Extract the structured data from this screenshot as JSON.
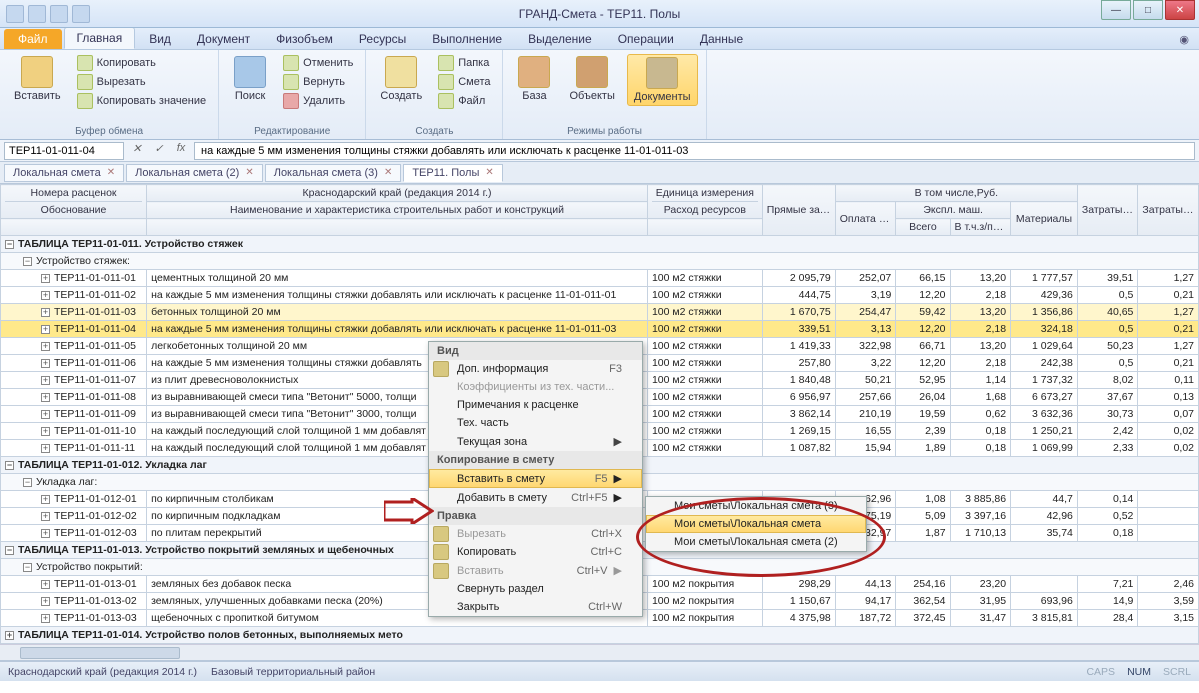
{
  "window": {
    "title": "ГРАНД-Смета - ТЕР11. Полы"
  },
  "ribbon": {
    "file": "Файл",
    "tabs": [
      "Главная",
      "Вид",
      "Документ",
      "Физобъем",
      "Ресурсы",
      "Выполнение",
      "Выделение",
      "Операции",
      "Данные"
    ],
    "active_tab": 0,
    "groups": {
      "clipboard": {
        "label": "Буфер обмена",
        "paste": "Вставить",
        "copy": "Копировать",
        "cut": "Вырезать",
        "copy_value": "Копировать значение"
      },
      "edit": {
        "label": "Редактирование",
        "find": "Поиск",
        "undo": "Отменить",
        "redo": "Вернуть",
        "delete": "Удалить"
      },
      "create": {
        "label": "Создать",
        "create": "Создать",
        "folder": "Папка",
        "estimate": "Смета",
        "file": "Файл"
      },
      "mode": {
        "label": "Режимы работы",
        "base": "База",
        "objects": "Объекты",
        "docs": "Документы"
      }
    }
  },
  "formula": {
    "ref": "ТЕР11-01-011-04",
    "text": "на каждые 5 мм изменения толщины стяжки добавлять или исключать к расценке 11-01-011-03"
  },
  "doctabs": [
    "Локальная смета",
    "Локальная смета (2)",
    "Локальная смета (3)",
    "ТЕР11. Полы"
  ],
  "columns": {
    "l1": "Номера расценок",
    "l2": "Обоснование",
    "region": "Краснодарский край (редакция 2014 г.)",
    "name": "Наименование и характеристика строительных работ и конструкций",
    "unit": "Единица измерения",
    "res": "Расход ресурсов",
    "direct": "Прямые затраты,Руб.",
    "intotal": "В том числе,Руб.",
    "pay": "Оплата труда рабочих",
    "expl": "Экспл. маш.",
    "all": "Всего",
    "mach": "В т.ч.з/пл маш-тов",
    "mat": "Материалы",
    "zt": "Затраты труда рабочих",
    "ztm": "Затраты труда маш-стов"
  },
  "groups": [
    {
      "title": "ТАБЛИЦА ТЕР11-01-011. Устройство стяжек",
      "sub": "Устройство стяжек:"
    },
    {
      "title": "ТАБЛИЦА ТЕР11-01-012. Укладка лаг",
      "sub": "Укладка лаг:"
    },
    {
      "title": "ТАБЛИЦА ТЕР11-01-013. Устройство покрытий земляных и щебеночных",
      "sub": "Устройство покрытий:"
    },
    {
      "title": "ТАБЛИЦА ТЕР11-01-014. Устройство полов бетонных, выполняемых мето"
    }
  ],
  "rows": [
    {
      "g": 0,
      "code": "ТЕР11-01-011-01",
      "name": "цементных толщиной 20 мм",
      "unit": "100 м2 стяжки",
      "v": [
        "2 095,79",
        "252,07",
        "66,15",
        "13,20",
        "1 777,57",
        "39,51",
        "1,27"
      ]
    },
    {
      "g": 0,
      "code": "ТЕР11-01-011-02",
      "name": "на каждые 5 мм изменения толщины стяжки добавлять или исключать к расценке 11-01-011-01",
      "unit": "100 м2 стяжки",
      "v": [
        "444,75",
        "3,19",
        "12,20",
        "2,18",
        "429,36",
        "0,5",
        "0,21"
      ]
    },
    {
      "g": 0,
      "code": "ТЕР11-01-011-03",
      "name": "бетонных толщиной 20 мм",
      "unit": "100 м2 стяжки",
      "v": [
        "1 670,75",
        "254,47",
        "59,42",
        "13,20",
        "1 356,86",
        "40,65",
        "1,27"
      ],
      "hl": true
    },
    {
      "g": 0,
      "code": "ТЕР11-01-011-04",
      "name": "на каждые 5 мм изменения толщины стяжки добавлять или исключать к расценке 11-01-011-03",
      "unit": "100 м2 стяжки",
      "v": [
        "339,51",
        "3,13",
        "12,20",
        "2,18",
        "324,18",
        "0,5",
        "0,21"
      ],
      "sel": true
    },
    {
      "g": 0,
      "code": "ТЕР11-01-011-05",
      "name": "легкобетонных толщиной 20 мм",
      "unit": "100 м2 стяжки",
      "v": [
        "1 419,33",
        "322,98",
        "66,71",
        "13,20",
        "1 029,64",
        "50,23",
        "1,27"
      ]
    },
    {
      "g": 0,
      "code": "ТЕР11-01-011-06",
      "name": "на каждые 5 мм изменения толщины стяжки добавлять",
      "unit": "100 м2 стяжки",
      "v": [
        "257,80",
        "3,22",
        "12,20",
        "2,18",
        "242,38",
        "0,5",
        "0,21"
      ]
    },
    {
      "g": 0,
      "code": "ТЕР11-01-011-07",
      "name": "из плит древесноволокнистых",
      "unit": "100 м2 стяжки",
      "v": [
        "1 840,48",
        "50,21",
        "52,95",
        "1,14",
        "1 737,32",
        "8,02",
        "0,11"
      ]
    },
    {
      "g": 0,
      "code": "ТЕР11-01-011-08",
      "name": "из выравнивающей смеси типа \"Ветонит\" 5000, толщи",
      "unit": "100 м2 стяжки",
      "v": [
        "6 956,97",
        "257,66",
        "26,04",
        "1,68",
        "6 673,27",
        "37,67",
        "0,13"
      ]
    },
    {
      "g": 0,
      "code": "ТЕР11-01-011-09",
      "name": "из выравнивающей смеси типа \"Ветонит\" 3000, толщи",
      "unit": "100 м2 стяжки",
      "v": [
        "3 862,14",
        "210,19",
        "19,59",
        "0,62",
        "3 632,36",
        "30,73",
        "0,07"
      ]
    },
    {
      "g": 0,
      "code": "ТЕР11-01-011-10",
      "name": "на каждый последующий слой толщиной 1 мм добавлят",
      "unit": "100 м2 стяжки",
      "v": [
        "1 269,15",
        "16,55",
        "2,39",
        "0,18",
        "1 250,21",
        "2,42",
        "0,02"
      ]
    },
    {
      "g": 0,
      "code": "ТЕР11-01-011-11",
      "name": "на каждый последующий слой толщиной 1 мм добавлят",
      "unit": "100 м2 стяжки",
      "v": [
        "1 087,82",
        "15,94",
        "1,89",
        "0,18",
        "1 069,99",
        "2,33",
        "0,02"
      ]
    },
    {
      "g": 1,
      "code": "ТЕР11-01-012-01",
      "name": "по кирпичным столбикам",
      "unit": "",
      "v": [
        "",
        "62,96",
        "1,08",
        "3 885,86",
        "44,7",
        "0,14",
        ""
      ]
    },
    {
      "g": 1,
      "code": "ТЕР11-01-012-02",
      "name": "по кирпичным подкладкам",
      "unit": "",
      "v": [
        "",
        "75,19",
        "5,09",
        "3 397,16",
        "42,96",
        "0,52",
        ""
      ]
    },
    {
      "g": 1,
      "code": "ТЕР11-01-012-03",
      "name": "по плитам перекрытий",
      "unit": "",
      "v": [
        "",
        "32,97",
        "1,87",
        "1 710,13",
        "35,74",
        "0,18",
        ""
      ]
    },
    {
      "g": 2,
      "code": "ТЕР11-01-013-01",
      "name": "земляных без добавок песка",
      "unit": "100 м2 покрытия",
      "v": [
        "298,29",
        "44,13",
        "254,16",
        "23,20",
        "",
        "7,21",
        "2,46"
      ]
    },
    {
      "g": 2,
      "code": "ТЕР11-01-013-02",
      "name": "земляных, улучшенных добавками песка (20%)",
      "unit": "100 м2 покрытия",
      "v": [
        "1 150,67",
        "94,17",
        "362,54",
        "31,95",
        "693,96",
        "14,9",
        "3,59"
      ]
    },
    {
      "g": 2,
      "code": "ТЕР11-01-013-03",
      "name": "щебеночных с пропиткой битумом",
      "unit": "100 м2 покрытия",
      "v": [
        "4 375,98",
        "187,72",
        "372,45",
        "31,47",
        "3 815,81",
        "28,4",
        "3,15"
      ]
    }
  ],
  "context_menu": {
    "main": {
      "section1": "Вид",
      "items1": [
        {
          "label": "Доп. информация",
          "shortcut": "F3",
          "ico": true
        },
        {
          "label": "Коэффициенты из тех. части...",
          "disabled": true
        },
        {
          "label": "Примечания к расценке"
        },
        {
          "label": "Тех. часть"
        },
        {
          "label": "Текущая зона",
          "arrow": true
        }
      ],
      "section2": "Копирование в смету",
      "items2": [
        {
          "label": "Вставить в смету",
          "shortcut": "F5",
          "arrow": true,
          "hl": true
        },
        {
          "label": "Добавить в смету",
          "shortcut": "Ctrl+F5",
          "arrow": true
        }
      ],
      "section3": "Правка",
      "items3": [
        {
          "label": "Вырезать",
          "shortcut": "Ctrl+X",
          "disabled": true,
          "ico": true
        },
        {
          "label": "Копировать",
          "shortcut": "Ctrl+C",
          "ico": true
        },
        {
          "label": "Вставить",
          "shortcut": "Ctrl+V",
          "arrow": true,
          "disabled": true,
          "ico": true
        },
        {
          "label": "Свернуть раздел"
        },
        {
          "label": "Закрыть",
          "shortcut": "Ctrl+W"
        }
      ]
    },
    "submenu": [
      "Мои сметы\\Локальная смета (3)",
      "Мои сметы\\Локальная смета",
      "Мои сметы\\Локальная смета (2)"
    ]
  },
  "status": {
    "left1": "Краснодарский край (редакция 2014 г.)",
    "left2": "Базовый территориальный район",
    "caps": "CAPS",
    "num": "NUM",
    "scrl": "SCRL"
  }
}
